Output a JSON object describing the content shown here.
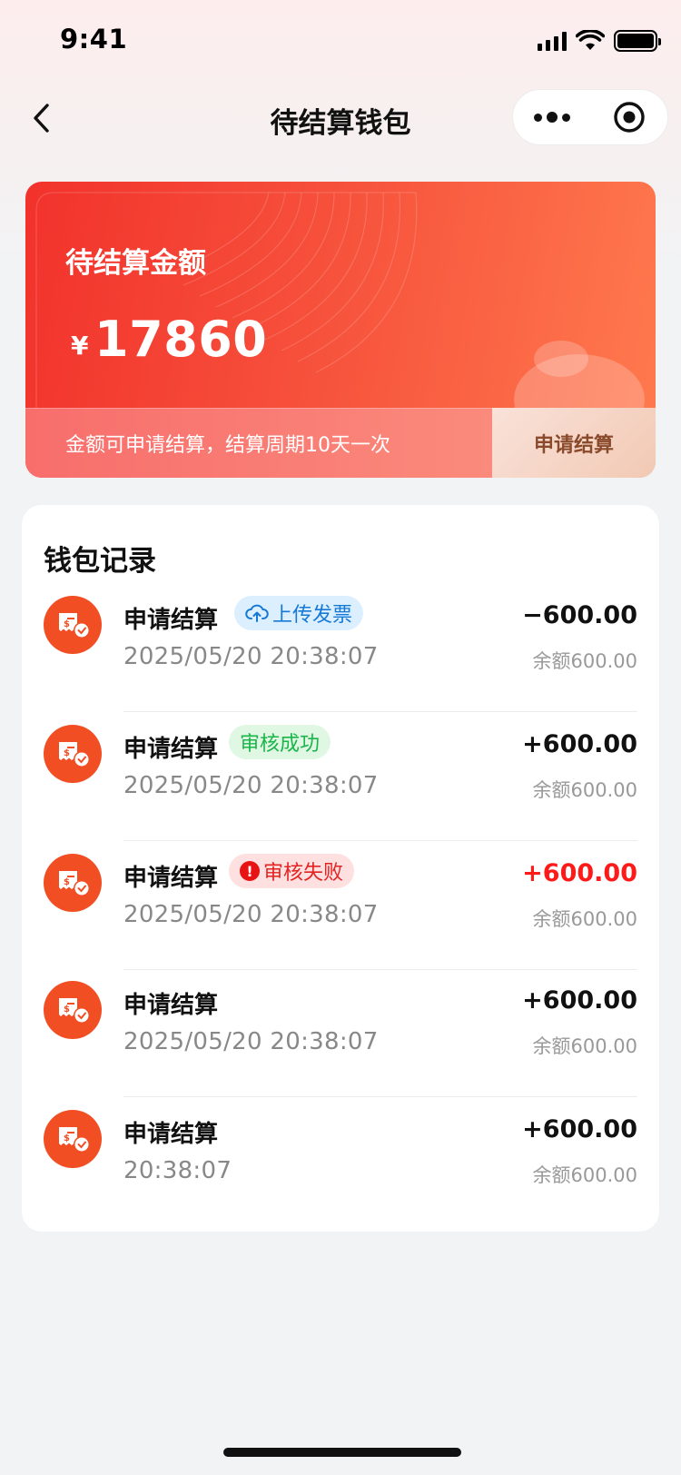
{
  "status_bar": {
    "time": "9:41"
  },
  "nav": {
    "title": "待结算钱包"
  },
  "balance_card": {
    "label": "待结算金额",
    "currency": "¥",
    "amount": "17860",
    "note": "金额可申请结算，结算周期10天一次",
    "apply_label": "申请结算"
  },
  "records": {
    "title": "钱包记录",
    "items": [
      {
        "title": "申请结算",
        "tag": "上传发票",
        "tag_type": "upload",
        "time": "2025/05/20 20:38:07",
        "amount": "−600.00",
        "balance": "余额600.00"
      },
      {
        "title": "申请结算",
        "tag": "审核成功",
        "tag_type": "success",
        "time": "2025/05/20 20:38:07",
        "amount": "+600.00",
        "balance": "余额600.00"
      },
      {
        "title": "申请结算",
        "tag": "审核失败",
        "tag_type": "fail",
        "time": "2025/05/20 20:38:07",
        "amount": "+600.00",
        "balance": "余额600.00"
      },
      {
        "title": "申请结算",
        "time": "2025/05/20 20:38:07",
        "amount": "+600.00",
        "balance": "余额600.00"
      },
      {
        "title": "申请结算",
        "time": "20:38:07",
        "amount": "+600.00",
        "balance": "余额600.00"
      }
    ]
  },
  "colors": {
    "card_start": "#f2322c",
    "card_end": "#ff7a4e",
    "record_icon": "#f24e24",
    "negative_amount": "#ff1a1a",
    "tag_blue": "#1779d6",
    "tag_green": "#1bb54a",
    "tag_red": "#e32222"
  },
  "icons": {
    "back": "chevron-left-icon",
    "more": "more-dots-icon",
    "close": "target-close-icon",
    "record": "receipt-check-icon",
    "upload": "cloud-upload-icon",
    "alert": "exclamation-icon"
  }
}
